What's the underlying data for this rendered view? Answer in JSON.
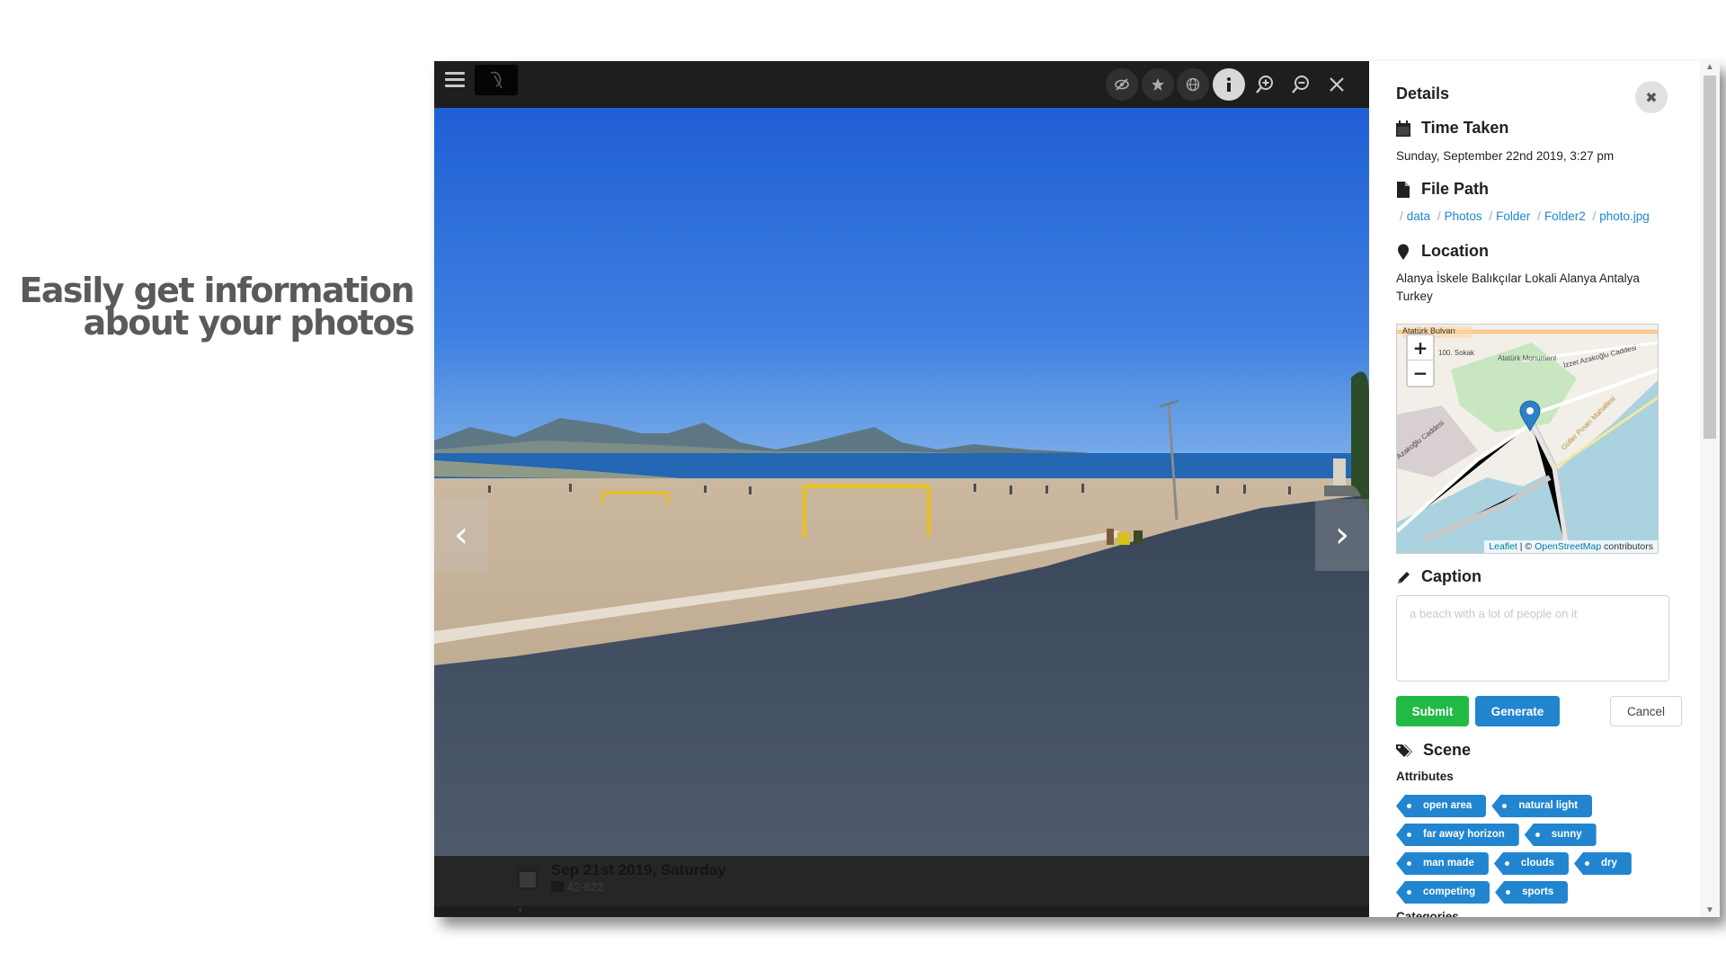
{
  "headline": {
    "line1": "Easily get information",
    "line2": "about your photos"
  },
  "viewer": {
    "toolbar_icons": [
      "menu-icon",
      "logo-icon",
      "eye-slash-icon",
      "star-icon",
      "globe-icon",
      "info-icon",
      "zoom-in-icon",
      "zoom-out-icon",
      "close-icon"
    ],
    "prev_arrow": "‹",
    "next_arrow": "›",
    "strip": {
      "date": "Sep 21st 2019, Saturday",
      "subtitle": "42-622"
    }
  },
  "panel": {
    "title": "Details",
    "time_taken": {
      "heading": "Time Taken",
      "value": "Sunday, September 22nd 2019, 3:27 pm"
    },
    "file_path": {
      "heading": "File Path",
      "segments": [
        "data",
        "Photos",
        "Folder",
        "Folder2",
        "photo.jpg"
      ]
    },
    "location": {
      "heading": "Location",
      "value_line1": "Alanya İskele Balıkçılar Lokali Alanya Antalya",
      "value_line2": "Turkey"
    },
    "map": {
      "labels": [
        "Atatürk Bulvarı",
        "100. Sokak",
        "Atatürk Monument",
        "İzzet Azakoğlu Caddesi",
        "Azakoğlu Caddesi",
        "Güller Pınarı Mahallesi"
      ],
      "zoom_in": "+",
      "zoom_out": "−",
      "attribution_link1": "Leaflet",
      "attribution_mid": " | © ",
      "attribution_link2": "OpenStreetMap",
      "attribution_end": " contributors"
    },
    "caption": {
      "heading": "Caption",
      "placeholder": "a beach with a lot of people on it",
      "submit": "Submit",
      "generate": "Generate",
      "cancel": "Cancel"
    },
    "scene": {
      "heading": "Scene",
      "attributes_label": "Attributes",
      "attributes": [
        "open area",
        "natural light",
        "far away horizon",
        "sunny",
        "man made",
        "clouds",
        "dry",
        "competing",
        "sports"
      ],
      "categories_label": "Categories"
    }
  },
  "colors": {
    "primary": "#2185d0",
    "success": "#21ba45",
    "toolbar": "#1e1e1e"
  }
}
